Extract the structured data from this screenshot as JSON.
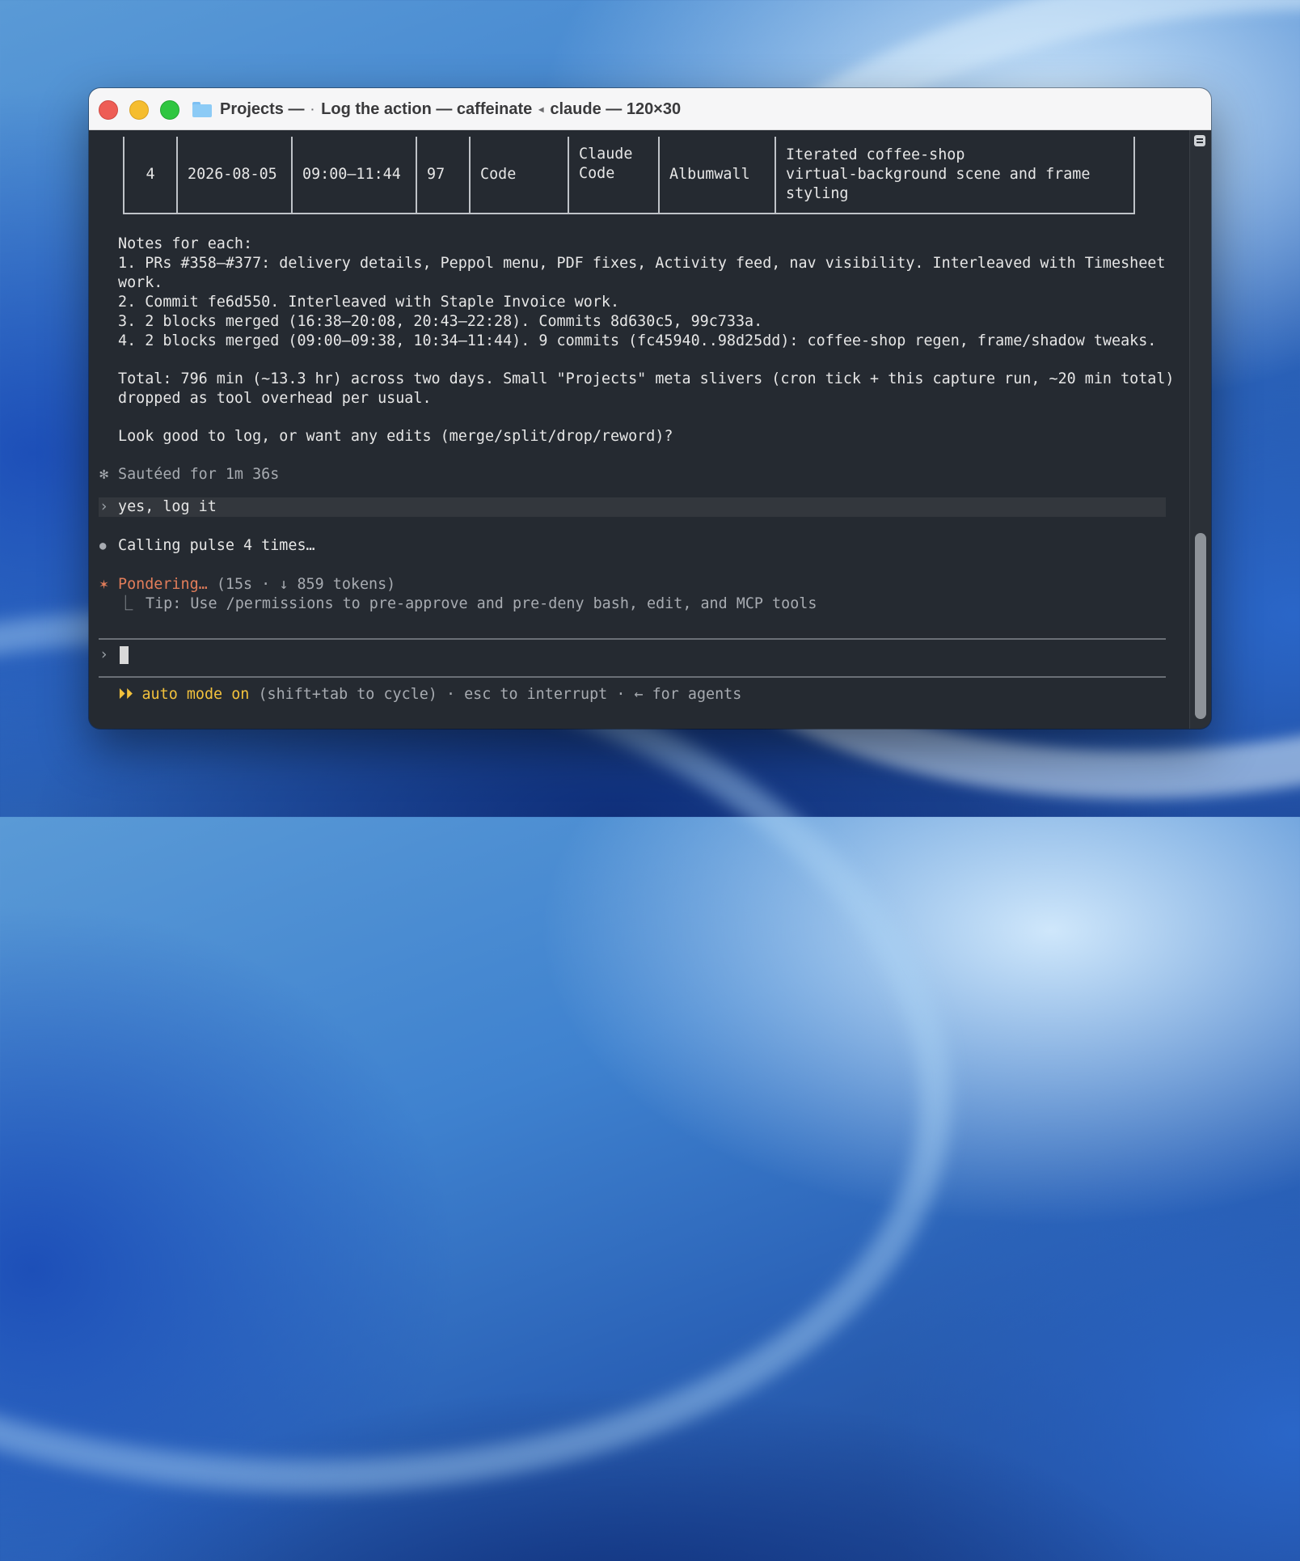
{
  "window": {
    "title_folder": "Projects —",
    "title_dot": "·",
    "title_action": "Log the action — caffeinate",
    "title_arrow": "◂",
    "title_rest": "claude — 120×30"
  },
  "table": {
    "row": [
      "4",
      "2026-08-05",
      "09:00–11:44",
      "97",
      "Code",
      "Claude\nCode",
      "Albumwall",
      "Iterated coffee-shop\nvirtual-background scene and frame\nstyling"
    ]
  },
  "notes": {
    "heading": "Notes for each:",
    "l1": "1. PRs #358–#377: delivery details, Peppol menu, PDF fixes, Activity feed, nav visibility. Interleaved with Timesheet",
    "l1b": "work.",
    "l2": "2. Commit fe6d550. Interleaved with Staple Invoice work.",
    "l3": "3. 2 blocks merged (16:38–20:08, 20:43–22:28). Commits 8d630c5, 99c733a.",
    "l4": "4. 2 blocks merged (09:00–09:38, 10:34–11:44). 9 commits (fc45940..98d25dd): coffee-shop regen, frame/shadow tweaks."
  },
  "total": {
    "l1": "Total: 796 min (~13.3 hr) across two days. Small \"Projects\" meta slivers (cron tick + this capture run, ~20 min total)",
    "l2": "dropped as tool overhead per usual."
  },
  "question": "Look good to log, or want any edits (merge/split/drop/reword)?",
  "status": {
    "sauteed_glyph": "✻",
    "sauteed": "Sautéed for 1m 36s",
    "user_glyph": "›",
    "user_msg": "yes, log it",
    "calling_glyph": "●",
    "calling": "Calling pulse 4 times…",
    "pondering_glyph": "✶",
    "pondering": "Pondering…",
    "pondering_meta": "(15s · ↓ 859 tokens)",
    "tip_glyph": "⎿",
    "tip": "Tip: Use /permissions to pre-approve and pre-deny bash, edit, and MCP tools"
  },
  "input": {
    "prompt_glyph": "›"
  },
  "footer": {
    "arrows": "⏵⏵",
    "mode": "auto mode on",
    "hint": "(shift+tab to cycle) · esc to interrupt · ← for agents"
  }
}
